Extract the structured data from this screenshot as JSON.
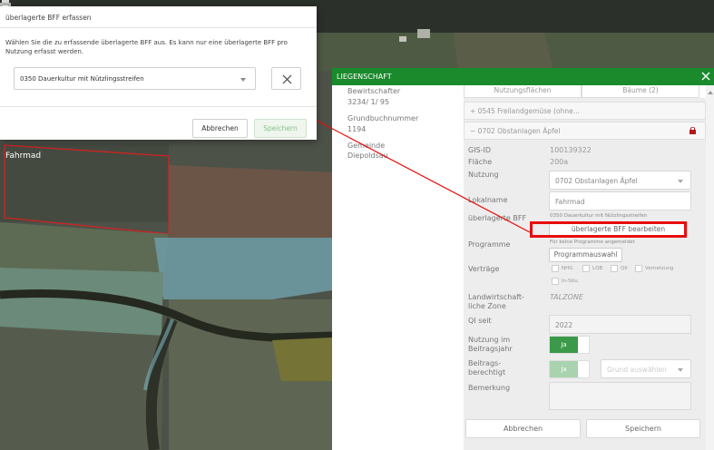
{
  "map": {
    "label": "Fahrmad",
    "colors": {
      "dark": "#3b4138",
      "field_dark": "#4a5046",
      "field_brown": "#6b5546",
      "field_green": "#63715a",
      "blue_strip": "#6ea4ae",
      "yellow_field": "#6b6a3a",
      "red_outline": "#d82020"
    }
  },
  "modal": {
    "title": "überlagerte BFF erfassen",
    "description": "Wählen Sie die zu erfassende überlagerte BFF aus. Es kann nur eine überlagerte BFF pro Nutzung erfasst werden.",
    "select_value": "0350 Dauerkultur mit Nützlingsstreifen",
    "cancel": "Abbrechen",
    "save": "Speichern"
  },
  "panel": {
    "header": "LIEGENSCHAFT",
    "left": {
      "bewirtschafter_label": "Bewirtschafter",
      "bewirtschafter_value": "3234/ 1/ 95",
      "grundbuch_label": "Grundbuchnummer",
      "grundbuch_value": "1194",
      "gemeinde_label_1": "Gemeinde",
      "gemeinde_value": "Diepoldsau"
    },
    "tabs": [
      "Nutzungsflächen",
      "Bäume (2)"
    ],
    "accordion": [
      "+ 0545 Freilandgemüse (ohne...",
      "− 0702 Obstanlagen Äpfel"
    ],
    "fields": {
      "gis_label": "GIS-ID",
      "gis_value": "100139322",
      "flaeche_label": "Fläche",
      "flaeche_value": "200a",
      "nutzung_label": "Nutzung",
      "nutzung_value": "0702 Obstanlagen Äpfel",
      "lokalname_label": "Lokalname",
      "lokalname_value": "Fahrmad",
      "bff_label": "überlagerte BFF",
      "bff_value": "0350 Dauerkultur mit Nützlingsstreifen",
      "bff_button": "überlagerte BFF bearbeiten",
      "programme_label": "Programme",
      "programme_note": "Für keine Programme angemeldet",
      "programme_button": "Programmauswahl",
      "vertraege_label": "Verträge",
      "vertraege": [
        "NHG",
        "LQB",
        "QII",
        "Vernetzung",
        "In-Situ"
      ],
      "zone_label_1": "Landwirtschaft-",
      "zone_label_2": "liche Zone",
      "zone_value": "TALZONE",
      "qi_label": "QI seit",
      "qi_value": "2022",
      "beitragsjahr_label_1": "Nutzung im",
      "beitragsjahr_label_2": "Beitragsjahr",
      "beitragsjahr_toggle": "Ja",
      "berechtigt_label_1": "Beitrags-",
      "berechtigt_label_2": "berechtigt",
      "berechtigt_toggle": "Ja",
      "berechtigt_select": "Grund auswählen",
      "bemerkung_label": "Bemerkung"
    },
    "footer": {
      "cancel": "Abbrechen",
      "save": "Speichern"
    }
  }
}
